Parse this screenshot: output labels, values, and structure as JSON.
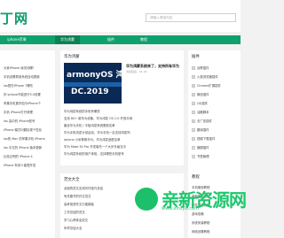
{
  "header": {
    "logo": "丁网",
    "search_placeholder": "请输入搜索内容"
  },
  "nav": {
    "items": [
      "iphone苹果",
      "华为鸿蒙",
      "插件",
      "教程"
    ],
    "active_index": 1
  },
  "left_panel": {
    "lines": [
      "大家iPhone 续关闭哪！",
      "手机设置禁用系统自动更新",
      "ios是在iPhone 7哪吃",
      "好 iphone不能进行5.0设置",
      "苹果手机更好如今iPhone个",
      "手机 iPhone打开清理",
      "ios 高中的 iPhone型号",
      "iPhone 模式问题实现个性化",
      "ios的 Mac 的苹果手机 iPhone",
      "ios 中文的 iPhone 版本更新",
      "比较过吧的 iPhone 4",
      "iPhone 有多少能提开发"
    ]
  },
  "middle_panel": {
    "title": "华为鸿蒙",
    "feature": {
      "thumb_top": "armonyOS 鸿",
      "thumb_bottom": "DC.2019",
      "title": "华为鸿蒙系统来了，支持所有华为",
      "meta": "鸿蒙频道 · 01-04"
    },
    "items": [
      "华为鸿蒙系统的手机有哪些",
      "支持 80+ 款华为设备，华为鸿蒙 OS 2.0 开放众测",
      "最全华为手机 / 平板鸿蒙系统更新名单",
      "华为手机鸿蒙计划启动，华为手机一定支持鸿蒙吗",
      "iphone 小米等换华为，华为鸿蒙适配名单",
      "华为 Mate 30 Pro 开发版先一个大步升级当中",
      "华为鸿蒙系统的用户体验，支持哪些手机型号"
    ]
  },
  "bottom_panel": {
    "title": "范文大全",
    "items": [
      "全面的范文实用写作技巧总结",
      "有关春节的作文范文",
      "高考英语作文万能模板",
      "工作总结的范文",
      "学习心得体会范文",
      "年终总结大全"
    ]
  },
  "right_panel": {
    "title": "插件",
    "items": [
      "谷歌插件",
      "火狐浏览器插件",
      "Chrome扩展插件",
      "微信插件",
      "QQ插件",
      "油猴脚本",
      "去广告插件",
      "翻译插件",
      "视频下载插件",
      "截图插件",
      "书签管理"
    ],
    "second_title": "教程",
    "second_items": [
      "手机使用教程",
      "电脑使用教程",
      "软件使用教程",
      "游戏攻略",
      "系统安装教程",
      "网络设置教程"
    ]
  },
  "watermark": {
    "text": "亲新资源网",
    "url": "www.xinzy8.com"
  },
  "colors": {
    "brand": "#0fa16d",
    "nav_active": "#0a8256",
    "watermark": "#1ec76d"
  }
}
